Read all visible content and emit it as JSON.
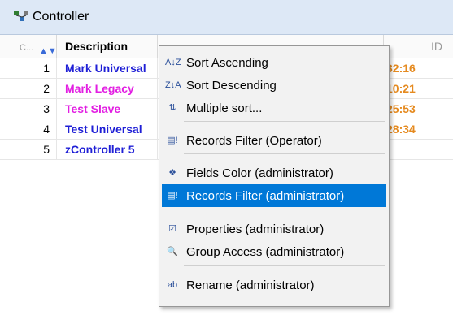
{
  "window": {
    "title": "Controller"
  },
  "table": {
    "headers": {
      "code": "C...",
      "description": "Description",
      "id": "ID"
    },
    "rows": [
      {
        "num": "1",
        "description": "Mark Universal",
        "time": "32:16",
        "color": "#1f1fd6"
      },
      {
        "num": "2",
        "description": "Mark Legacy",
        "time": "10:21",
        "color": "#e21ee2"
      },
      {
        "num": "3",
        "description": "Test Slave",
        "time": "25:53",
        "color": "#e21ee2"
      },
      {
        "num": "4",
        "description": "Test Universal",
        "time": "28:34",
        "color": "#1f1fd6"
      },
      {
        "num": "5",
        "description": "zController 5",
        "time": "",
        "color": "#1f1fd6"
      }
    ]
  },
  "menu": {
    "items": [
      {
        "label": "Sort Ascending",
        "icon": "sort-ascending-icon",
        "glyph": "A↓Z"
      },
      {
        "label": "Sort Descending",
        "icon": "sort-descending-icon",
        "glyph": "Z↓A"
      },
      {
        "label": "Multiple sort...",
        "icon": "multiple-sort-icon",
        "glyph": "⇅"
      },
      {
        "label": "Records Filter (Operator)",
        "icon": "records-filter-icon",
        "glyph": "▤!"
      },
      {
        "label": "Fields Color (administrator)",
        "icon": "fields-color-icon",
        "glyph": "❖"
      },
      {
        "label": "Records Filter (administrator)",
        "icon": "records-filter-admin-icon",
        "glyph": "▤!",
        "selected": true
      },
      {
        "label": "Properties (administrator)",
        "icon": "properties-icon",
        "glyph": "☑"
      },
      {
        "label": "Group Access (administrator)",
        "icon": "group-access-icon",
        "glyph": "🔍"
      },
      {
        "label": "Rename (administrator)",
        "icon": "rename-icon",
        "glyph": "ab"
      }
    ],
    "accent": "#0078d7"
  }
}
